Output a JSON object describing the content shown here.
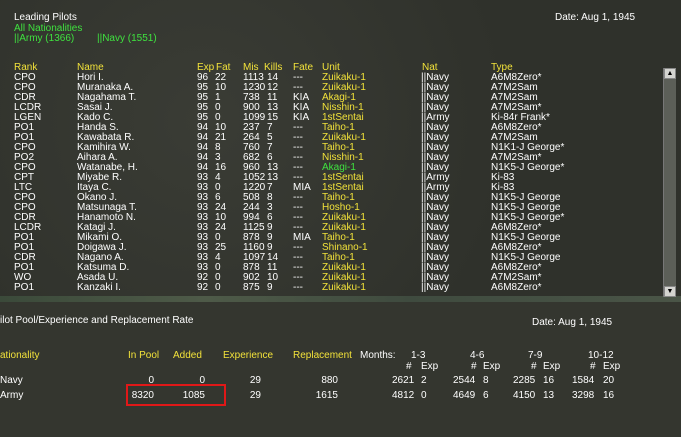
{
  "header": {
    "title": "Leading Pilots",
    "filter": "All Nationalities",
    "army_count": "||Army (1366)",
    "navy_count": "||Navy (1551)",
    "date": "Date: Aug 1, 1945"
  },
  "columns": {
    "rank": "Rank",
    "name": "Name",
    "exp": "Exp",
    "fat": "Fat",
    "mis": "Mis",
    "kills": "Kills",
    "fate": "Fate",
    "unit": "Unit",
    "nat": "Nat",
    "type": "Type"
  },
  "pilots": [
    {
      "rank": "CPO",
      "name": "Hori I.",
      "exp": "96",
      "fat": "22",
      "mis": "1113",
      "kills": "14",
      "fate": "---",
      "unit": "Zuikaku-1",
      "unit_color": "yellow",
      "nat": "||Navy",
      "type": "A6M8Zero*"
    },
    {
      "rank": "CPO",
      "name": "Muranaka A.",
      "exp": "95",
      "fat": "10",
      "mis": "1230",
      "kills": "12",
      "fate": "---",
      "unit": "Zuikaku-1",
      "unit_color": "yellow",
      "nat": "||Navy",
      "type": "A7M2Sam"
    },
    {
      "rank": "CDR",
      "name": "Nagahama T.",
      "exp": "95",
      "fat": "1",
      "mis": "738",
      "kills": "11",
      "fate": "KIA",
      "unit": "Akagi-1",
      "unit_color": "yellow",
      "nat": "||Navy",
      "type": "A7M2Sam"
    },
    {
      "rank": "LCDR",
      "name": "Sasai J.",
      "exp": "95",
      "fat": "0",
      "mis": "900",
      "kills": "13",
      "fate": "KIA",
      "unit": "Nisshin-1",
      "unit_color": "yellow",
      "nat": "||Navy",
      "type": "A7M2Sam*"
    },
    {
      "rank": "LGEN",
      "name": "Kado C.",
      "exp": "95",
      "fat": "0",
      "mis": "1099",
      "kills": "15",
      "fate": "KIA",
      "unit": "1stSentai",
      "unit_color": "yellow",
      "nat": "||Army",
      "type": "Ki-84r Frank*"
    },
    {
      "rank": "PO1",
      "name": "Handa S.",
      "exp": "94",
      "fat": "10",
      "mis": "237",
      "kills": "7",
      "fate": "---",
      "unit": "Taiho-1",
      "unit_color": "yellow",
      "nat": "||Navy",
      "type": "A6M8Zero*"
    },
    {
      "rank": "PO1",
      "name": "Kawabata R.",
      "exp": "94",
      "fat": "21",
      "mis": "264",
      "kills": "5",
      "fate": "---",
      "unit": "Zuikaku-1",
      "unit_color": "yellow",
      "nat": "||Navy",
      "type": "A7M2Sam"
    },
    {
      "rank": "CPO",
      "name": "Kamihira W.",
      "exp": "94",
      "fat": "8",
      "mis": "760",
      "kills": "7",
      "fate": "---",
      "unit": "Taiho-1",
      "unit_color": "yellow",
      "nat": "||Navy",
      "type": "N1K1-J George*"
    },
    {
      "rank": "PO2",
      "name": "Aihara A.",
      "exp": "94",
      "fat": "3",
      "mis": "682",
      "kills": "6",
      "fate": "---",
      "unit": "Nisshin-1",
      "unit_color": "yellow",
      "nat": "||Navy",
      "type": "A7M2Sam*"
    },
    {
      "rank": "CPO",
      "name": "Watanabe, H.",
      "exp": "94",
      "fat": "16",
      "mis": "960",
      "kills": "13",
      "fate": "---",
      "unit": "Akagi-1",
      "unit_color": "green",
      "nat": "||Navy",
      "type": "N1K5-J George*"
    },
    {
      "rank": "CPT",
      "name": "Miyabe R.",
      "exp": "93",
      "fat": "4",
      "mis": "1052",
      "kills": "13",
      "fate": "---",
      "unit": "1stSentai",
      "unit_color": "yellow",
      "nat": "||Army",
      "type": "Ki-83"
    },
    {
      "rank": "LTC",
      "name": "Itaya C.",
      "exp": "93",
      "fat": "0",
      "mis": "1220",
      "kills": "7",
      "fate": "MIA",
      "unit": "1stSentai",
      "unit_color": "yellow",
      "nat": "||Army",
      "type": "Ki-83"
    },
    {
      "rank": "CPO",
      "name": "Okano J.",
      "exp": "93",
      "fat": "6",
      "mis": "508",
      "kills": "8",
      "fate": "---",
      "unit": "Taiho-1",
      "unit_color": "yellow",
      "nat": "||Navy",
      "type": "N1K5-J George"
    },
    {
      "rank": "CPO",
      "name": "Matsunaga T.",
      "exp": "93",
      "fat": "24",
      "mis": "244",
      "kills": "3",
      "fate": "---",
      "unit": "Hosho-1",
      "unit_color": "yellow",
      "nat": "||Navy",
      "type": "N1K5-J George"
    },
    {
      "rank": "CDR",
      "name": "Hanamoto N.",
      "exp": "93",
      "fat": "10",
      "mis": "994",
      "kills": "6",
      "fate": "---",
      "unit": "Zuikaku-1",
      "unit_color": "yellow",
      "nat": "||Navy",
      "type": "N1K5-J George*"
    },
    {
      "rank": "LCDR",
      "name": "Katagi J.",
      "exp": "93",
      "fat": "24",
      "mis": "1125",
      "kills": "9",
      "fate": "---",
      "unit": "Zuikaku-1",
      "unit_color": "yellow",
      "nat": "||Navy",
      "type": "A6M8Zero*"
    },
    {
      "rank": "PO1",
      "name": "Mikami O.",
      "exp": "93",
      "fat": "0",
      "mis": "878",
      "kills": "9",
      "fate": "MIA",
      "unit": "Taiho-1",
      "unit_color": "yellow",
      "nat": "||Navy",
      "type": "N1K5-J George"
    },
    {
      "rank": "PO1",
      "name": "Doigawa J.",
      "exp": "93",
      "fat": "25",
      "mis": "1160",
      "kills": "9",
      "fate": "---",
      "unit": "Shinano-1",
      "unit_color": "yellow",
      "nat": "||Navy",
      "type": "A6M8Zero*"
    },
    {
      "rank": "CDR",
      "name": "Nagano A.",
      "exp": "93",
      "fat": "4",
      "mis": "1097",
      "kills": "14",
      "fate": "---",
      "unit": "Taiho-1",
      "unit_color": "yellow",
      "nat": "||Navy",
      "type": "N1K5-J George"
    },
    {
      "rank": "PO1",
      "name": "Katsuma D.",
      "exp": "93",
      "fat": "0",
      "mis": "878",
      "kills": "11",
      "fate": "---",
      "unit": "Zuikaku-1",
      "unit_color": "yellow",
      "nat": "||Navy",
      "type": "A6M8Zero*"
    },
    {
      "rank": "WO",
      "name": "Asada U.",
      "exp": "92",
      "fat": "0",
      "mis": "902",
      "kills": "10",
      "fate": "---",
      "unit": "Zuikaku-1",
      "unit_color": "yellow",
      "nat": "||Navy",
      "type": "A7M2Sam*"
    },
    {
      "rank": "PO1",
      "name": "Kanzaki I.",
      "exp": "92",
      "fat": "0",
      "mis": "875",
      "kills": "9",
      "fate": "---",
      "unit": "Zuikaku-1",
      "unit_color": "yellow",
      "nat": "||Navy",
      "type": "A6M8Zero*"
    }
  ],
  "pool": {
    "title": "ilot Pool/Experience and Replacement Rate",
    "date": "Date: Aug 1, 1945",
    "headers": {
      "nationality": "ationality",
      "in_pool": "In Pool",
      "added": "Added",
      "experience": "Experience",
      "replacement": "Replacement",
      "months": "Months:",
      "m1": "1-3",
      "m2": "4-6",
      "m3": "7-9",
      "m4": "10-12",
      "num": "#",
      "exp": "Exp"
    },
    "rows": [
      {
        "nat": "Navy",
        "in_pool": "0",
        "added": "0",
        "experience": "29",
        "replacement": "880",
        "m1n": "2621",
        "m1e": "2",
        "m2n": "2544",
        "m2e": "8",
        "m3n": "2285",
        "m3e": "16",
        "m4n": "1584",
        "m4e": "20"
      },
      {
        "nat": "Army",
        "in_pool": "8320",
        "added": "1085",
        "experience": "29",
        "replacement": "1615",
        "m1n": "4812",
        "m1e": "0",
        "m2n": "4649",
        "m2e": "6",
        "m3n": "4150",
        "m3e": "13",
        "m4n": "3298",
        "m4e": "16"
      }
    ]
  },
  "colors": {
    "green": "#3fe23f",
    "yellow": "#f2e23a",
    "highlight": "#e01818"
  },
  "icons": {
    "scroll_up": "▲",
    "scroll_down": "▼"
  }
}
